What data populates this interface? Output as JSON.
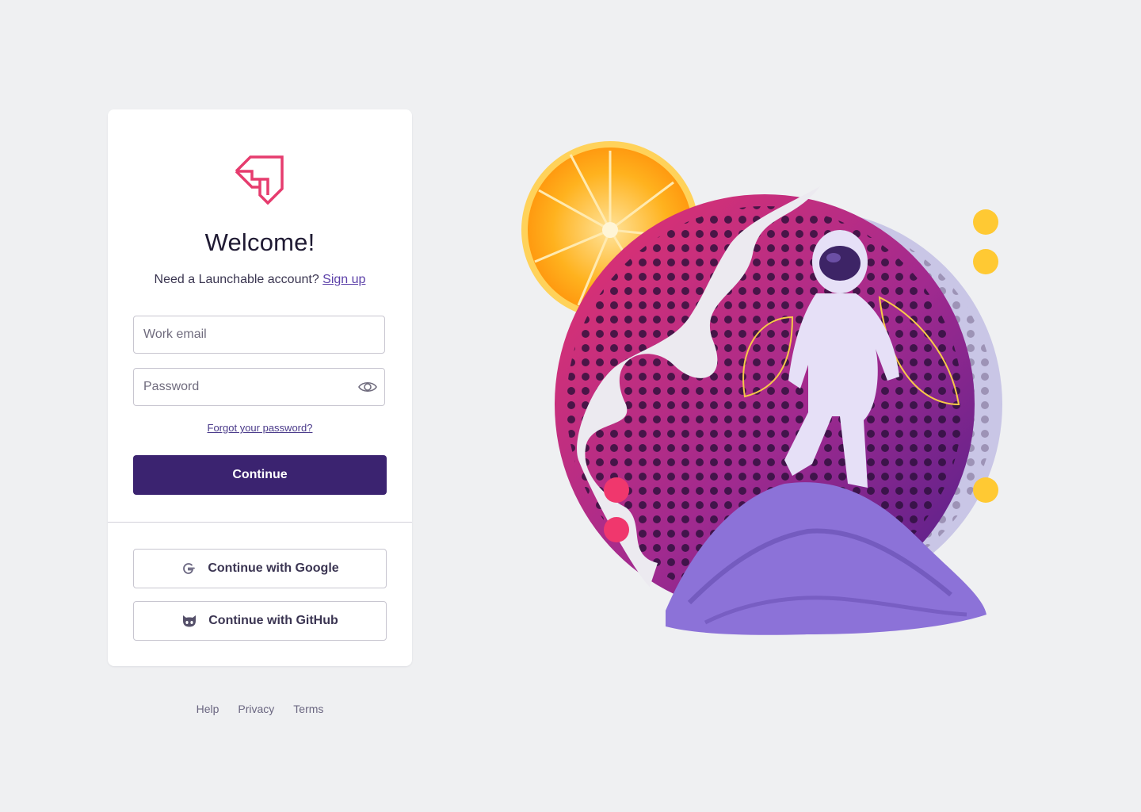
{
  "brand": {
    "logo_icon": "launchable-logo-icon",
    "accent": "#e63c6e"
  },
  "login": {
    "title": "Welcome!",
    "subtitle_prefix": "Need a Launchable account?",
    "signup_link": "Sign up",
    "email_placeholder": "Work email",
    "password_placeholder": "Password",
    "password_toggle_icon": "eye-icon",
    "forgot_link": "Forgot your password?",
    "continue_label": "Continue",
    "continue_color": "#3b2370"
  },
  "sso": {
    "google_label": "Continue with Google",
    "google_icon": "google-icon",
    "github_label": "Continue with GitHub",
    "github_icon": "github-icon"
  },
  "footer": {
    "links": [
      "Help",
      "Privacy",
      "Terms"
    ]
  },
  "illustration": {
    "description_icon": "astronaut-illustration",
    "colors": [
      "#ff9f1a",
      "#e8336d",
      "#6a2fa0",
      "#ffc933",
      "#b9a6ea"
    ]
  }
}
